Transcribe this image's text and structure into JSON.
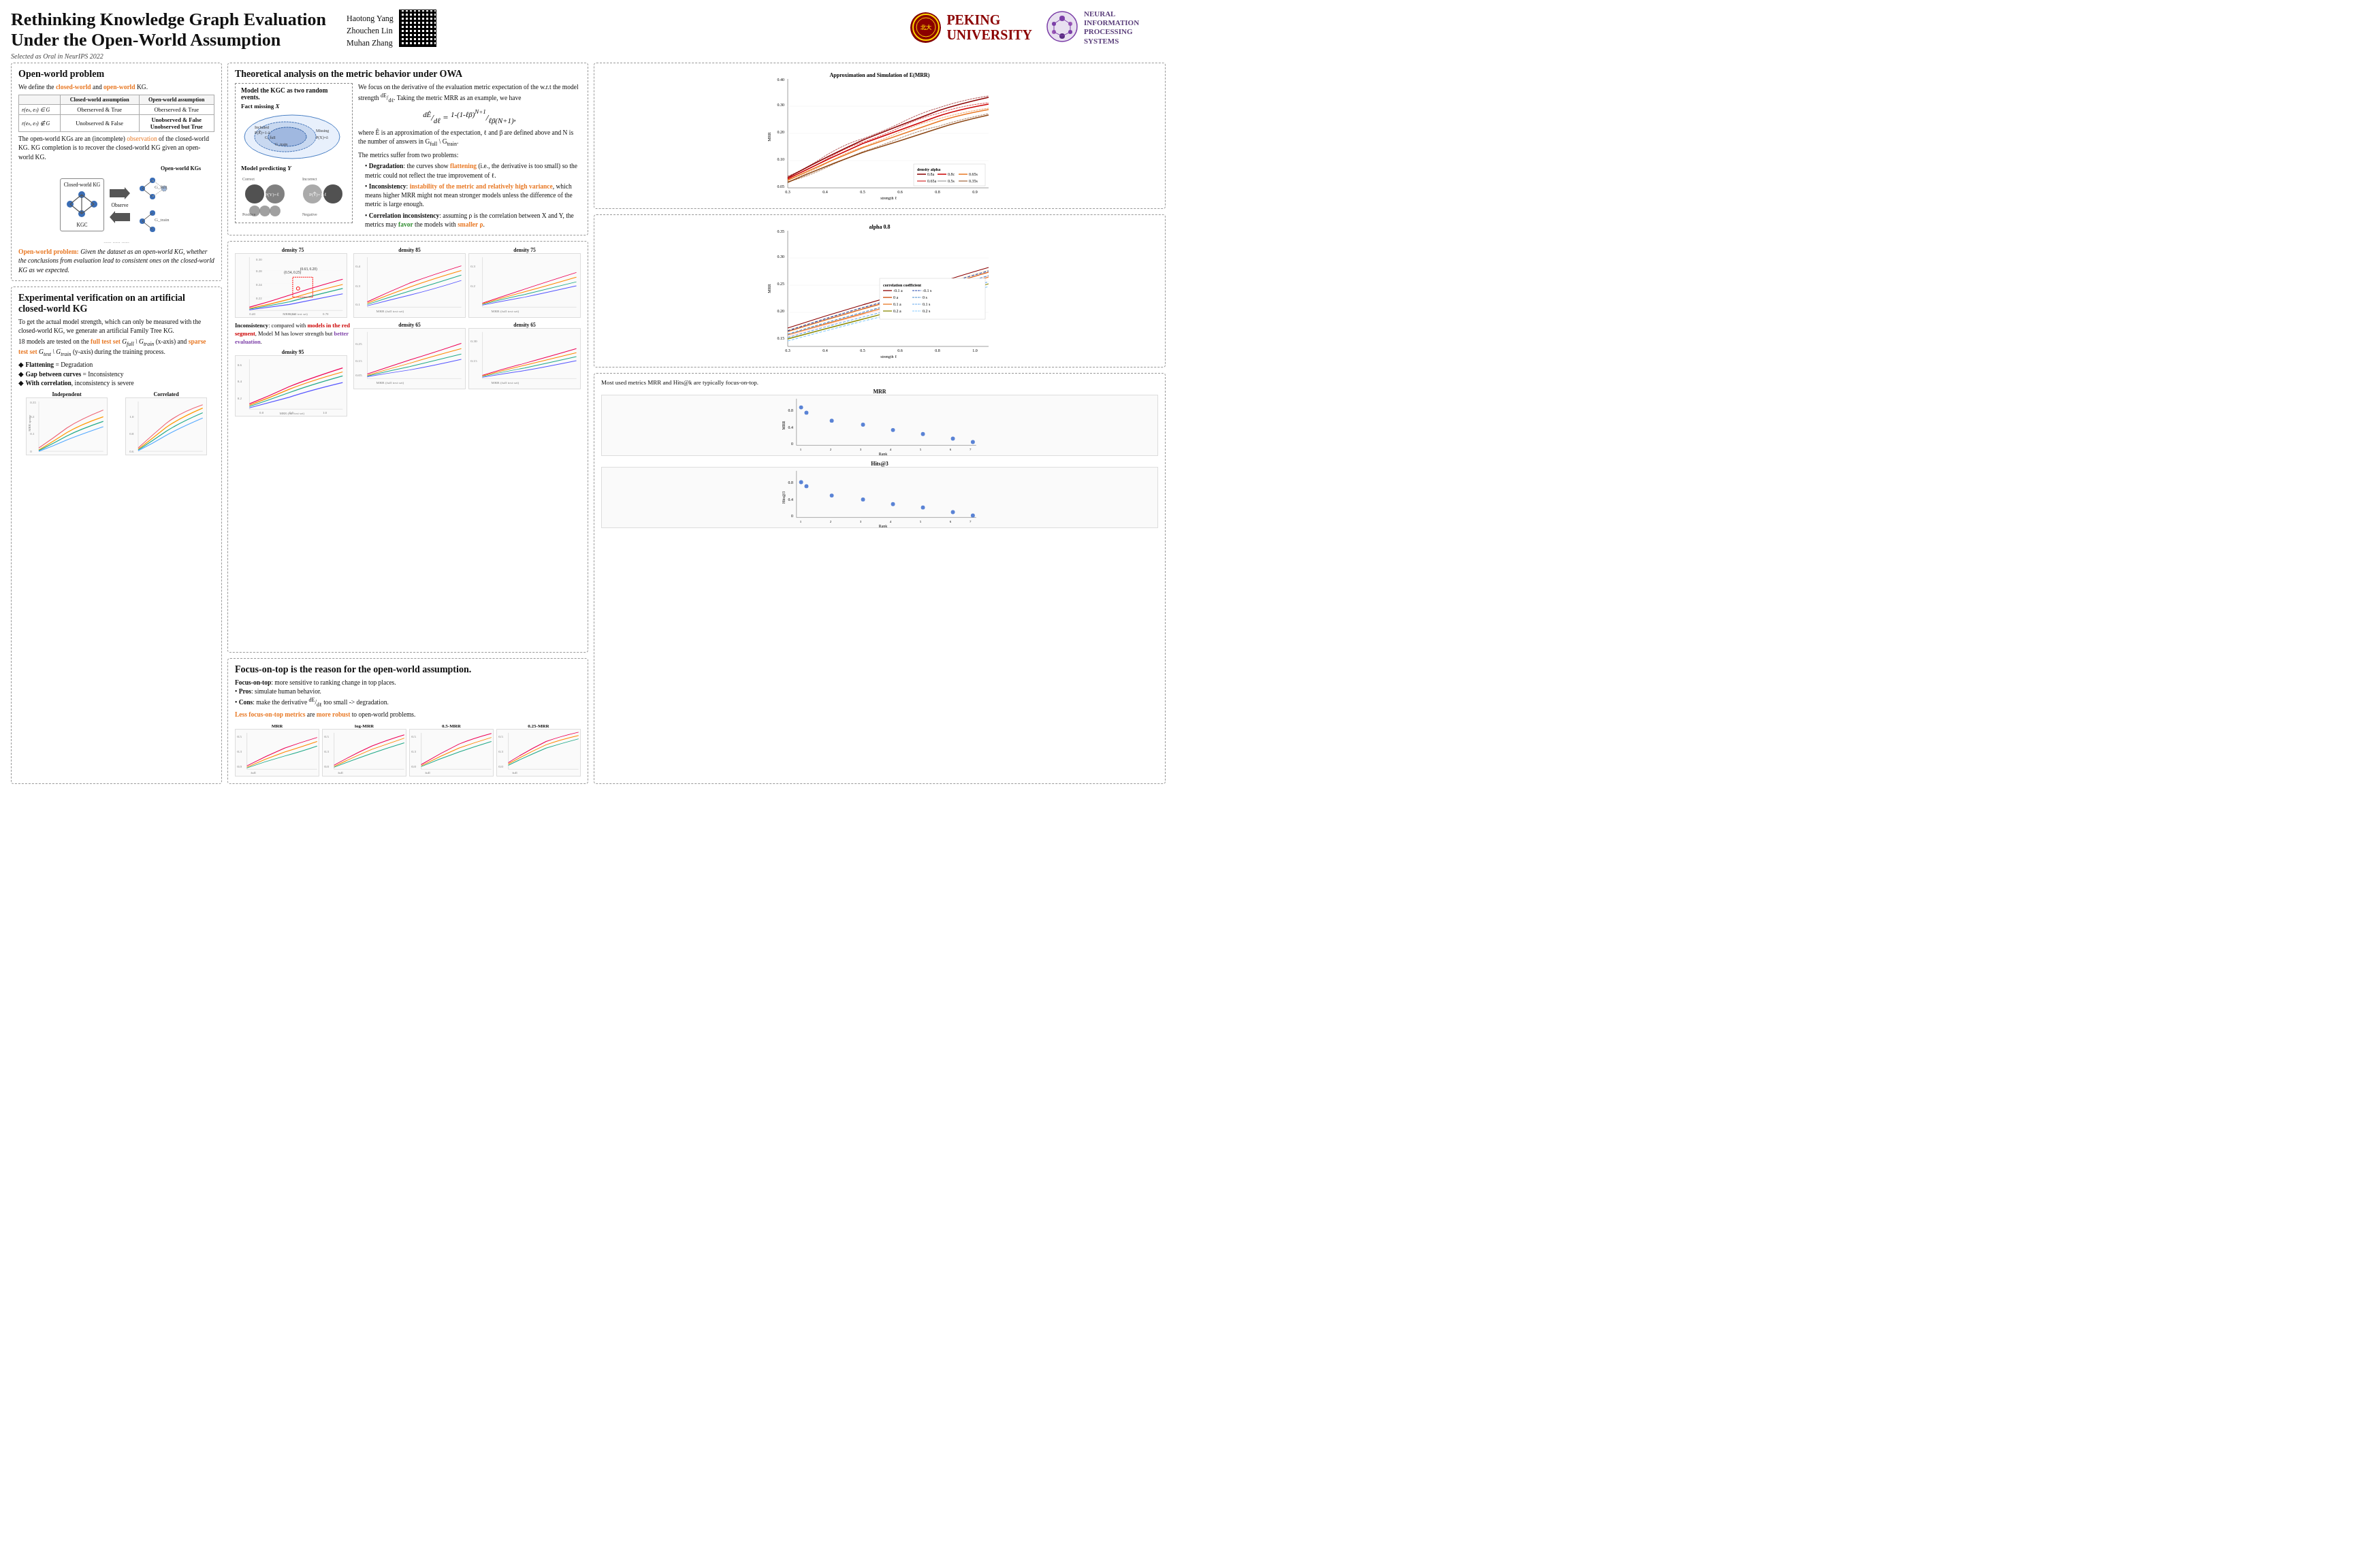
{
  "header": {
    "title_line1": "Rethinking Knowledge Graph Evaluation",
    "title_line2": "Under the Open-World Assumption",
    "oral": "Selected as Oral in NeurIPS 2022",
    "authors": [
      "Haotong Yang",
      "Zhouchen Lin",
      "Muhan Zhang"
    ],
    "peking_text": "PEKING\nUNIVERSITY",
    "neurips_text": "NEURAL INFORMATION\nPROCESSING SYSTEMS"
  },
  "sections": {
    "open_world": {
      "title": "Open-world problem",
      "intro": "We define the closed-world and open-world KG.",
      "table": {
        "headers": [
          "",
          "Closed-world assumption",
          "Open-world assumption"
        ],
        "rows": [
          [
            "r(eₕ, eₜ) ∈ G",
            "Oberserved & True",
            "Oberserved & True"
          ],
          [
            "r(eₕ, eₜ) ∉ G",
            "Unobserved & False",
            "Unobserved & False\nUnobserved but True"
          ]
        ]
      },
      "text1": "The open-world KGs are an (incomplete) observation of the closed-world KG. KG completion is to recover the closed-world KG given an open-world KG.",
      "kg_label": "Open-world KGs",
      "cw_label": "Closed-world KG",
      "kgc_label": "KGC",
      "observe_label": "Observe",
      "problem_text": "Open-world problem: Given the dataset as an open-world KG, whether the conclusions from evaluation lead to consistent ones on the closed-world KG as we expected.",
      "bullets": [
        "Flattening = Degradation",
        "Gap between curves = Inconsistency",
        "With correlation, inconsistency is severe"
      ]
    },
    "theoretical": {
      "title": "Theoretical analysis on the metric behavior under OWA",
      "model_box_title": "Model the KGC as two random events.",
      "fact_missing": "Fact missing X",
      "model_predict": "Model predicting Y",
      "included_label": "Included",
      "missing_label": "Missing",
      "correct_label": "Correct",
      "incorrect_label": "Incorrect",
      "positive_label": "Positive",
      "negative_label": "Negative",
      "px_formula": "P(X̄) = 1 - δ",
      "px2_formula": "P(X) = δ",
      "py_formula": "P(Y) = ℓ",
      "py2_formula": "P(Ȳ) = 1 - ℓ",
      "text1": "We focus on the derivative of the evaluation metric expectation of the w.r.t the model strength dE/dℓ. Taking the metric MRR as an example, we have",
      "formula": "dE/dℓ = (1-(1-ℓβ)^(N+1)) / (ℓβ(N+1))",
      "text2": "where E is an approximation of the expectation, ℓ and β are defined above and N is the number of answers in G_full \\ G_train.",
      "problems_title": "The metrics suffer from two problems:",
      "degradation": "Degradation: the curves show flattening (i.e., the derivative is too small) so the metric could not reflect the true improvement of ℓ.",
      "inconsistency": "Inconsistency: instability of the metric and relatively high variance, which means higher MRR might not mean stronger models unless the difference of the metric is large enough.",
      "correlation": "Correlation inconsistency: assuming ρ is the correlation between X and Y, the metrics may favor the models with smaller ρ."
    },
    "experimental": {
      "title": "Experimental verification on an artificial closed-world KG",
      "text1": "To get the actual model strength, which can only be measured with the closed-world KG, we generate an artificial Family Tree KG.",
      "text2": "18 models are tested on the full test set G_full \\ G_train (x-axis) and sparse test set G_test \\ G_train (y-axis) during the training process.",
      "inconsistency_note": "Inconsistency: compared with models in the red segment, Model M has lower strength but better evaluation.",
      "density_labels": [
        "density 75",
        "density 95",
        "density 85",
        "density 75",
        "density 65"
      ],
      "independent_label": "Independent",
      "correlated_label": "Correlated",
      "axis_full": "MRR (full test set)",
      "axis_sparse": "MRR (sparse test set)"
    },
    "focus_top": {
      "title": "Focus-on-top is the reason for the open-world assumption.",
      "pros_cons": "Focus-on-top: more sensitive to ranking change in top places.",
      "pros": "Pros: simulate human behavior.",
      "cons": "Cons: make the derivative dE/dℓ too small -> degradation.",
      "less_focus": "Less focus-on-top metrics are more robust to open-world problems.",
      "metrics": [
        "MRR",
        "log-MRR",
        "0.5-MRR",
        "0.25-MRR"
      ],
      "mrr_note": "Most used metrics MRR and Hits@k are typically focus-on-top.",
      "mrr_title": "MRR",
      "hits_title": "Hits@3"
    },
    "approx_chart": {
      "title": "Approximation and Simulation of E(MRR)",
      "legend": [
        "0.8a",
        "0.65a",
        "0.5a",
        "0.35a",
        "0.8c",
        "0.65c",
        "0.5c",
        "0.35c"
      ],
      "x_label": "strength ℓ",
      "y_label": "MRR",
      "x_range": [
        0.3,
        1.0
      ],
      "y_range": [
        0.05,
        0.4
      ]
    },
    "alpha_chart": {
      "title": "alpha 0.8",
      "legend_title": "correlation coefficient",
      "legend": [
        "-0.1 a",
        "0 a",
        "0.1 a",
        "0.2 a",
        "-0.1 s",
        "0 s",
        "0.1 s",
        "0.2 s"
      ],
      "x_label": "strength ℓ",
      "y_label": "MRR",
      "x_range": [
        0.3,
        1.0
      ],
      "y_range": [
        0.1,
        0.35
      ]
    }
  }
}
